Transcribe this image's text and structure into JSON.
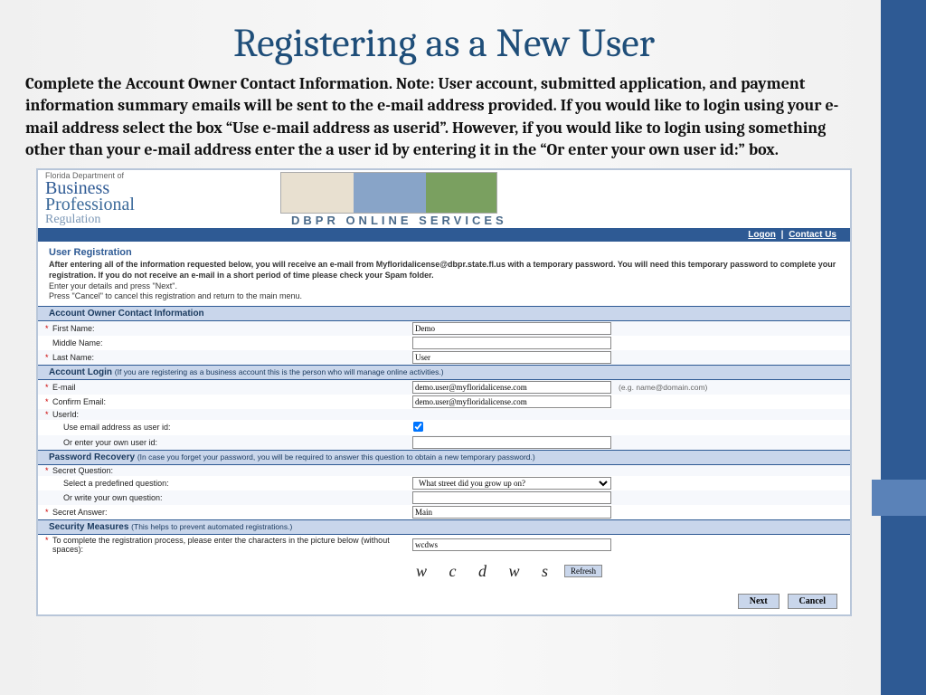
{
  "title": "Registering as a New User",
  "body": "Complete the Account Owner Contact Information. Note: User account, submitted application, and payment information summary emails will be sent to the e-mail address provided. If you would like to login using your e-mail address select the box “Use e-mail address as userid”. However, if you would like to login using something other than your e-mail address enter the a user id by entering it in the “Or enter your own user id:” box.",
  "screenshot": {
    "logo": {
      "line1": "Florida Department of",
      "line2a": "Business",
      "line2b": "Professional",
      "line3": "Regulation"
    },
    "banner_text": "DBPR   ONLINE SERVICES",
    "topbar": {
      "logon": "Logon",
      "contact": "Contact Us"
    },
    "intro": {
      "heading": "User Registration",
      "bold": "After entering all of the information requested below, you will receive an e-mail from Myfloridalicense@dbpr.state.fl.us with a temporary password. You will need this temporary password to complete your registration. If you do not receive an e-mail in a short period of time please check your Spam folder.",
      "line2": "Enter your details and press \"Next\".",
      "line3": "Press \"Cancel\" to cancel this registration and return to the main menu."
    },
    "sections": {
      "contact": "Account Owner Contact Information",
      "login": "Account Login",
      "login_sub": "(If you are registering as a business account this is the person who will manage online activities.)",
      "recovery": "Password Recovery",
      "recovery_sub": "(In case you forget your password, you will be required to answer this question to obtain a new temporary password.)",
      "security": "Security Measures",
      "security_sub": "(This helps to prevent automated registrations.)"
    },
    "fields": {
      "first_name_label": "First Name:",
      "first_name": "Demo",
      "middle_name_label": "Middle Name:",
      "middle_name": "",
      "last_name_label": "Last Name:",
      "last_name": "User",
      "email_label": "E-mail",
      "email": "demo.user@myfloridalicense.com",
      "email_hint": "(e.g. name@domain.com)",
      "confirm_email_label": "Confirm Email:",
      "confirm_email": "demo.user@myfloridalicense.com",
      "userid_label": "UserId:",
      "use_email_label": "Use email address as user id:",
      "own_userid_label": "Or enter your own user id:",
      "own_userid": "",
      "secret_q_label": "Secret Question:",
      "predef_label": "Select a predefined question:",
      "predef_value": "What street did you grow up on?",
      "own_q_label": "Or write your own question:",
      "own_q": "",
      "answer_label": "Secret Answer:",
      "answer": "Main",
      "captcha_label": "To complete the registration process, please enter the characters in the picture below (without spaces):",
      "captcha_value": "wcdws",
      "captcha_img": "w  c d  w s"
    },
    "buttons": {
      "refresh": "Refresh",
      "next": "Next",
      "cancel": "Cancel"
    }
  }
}
